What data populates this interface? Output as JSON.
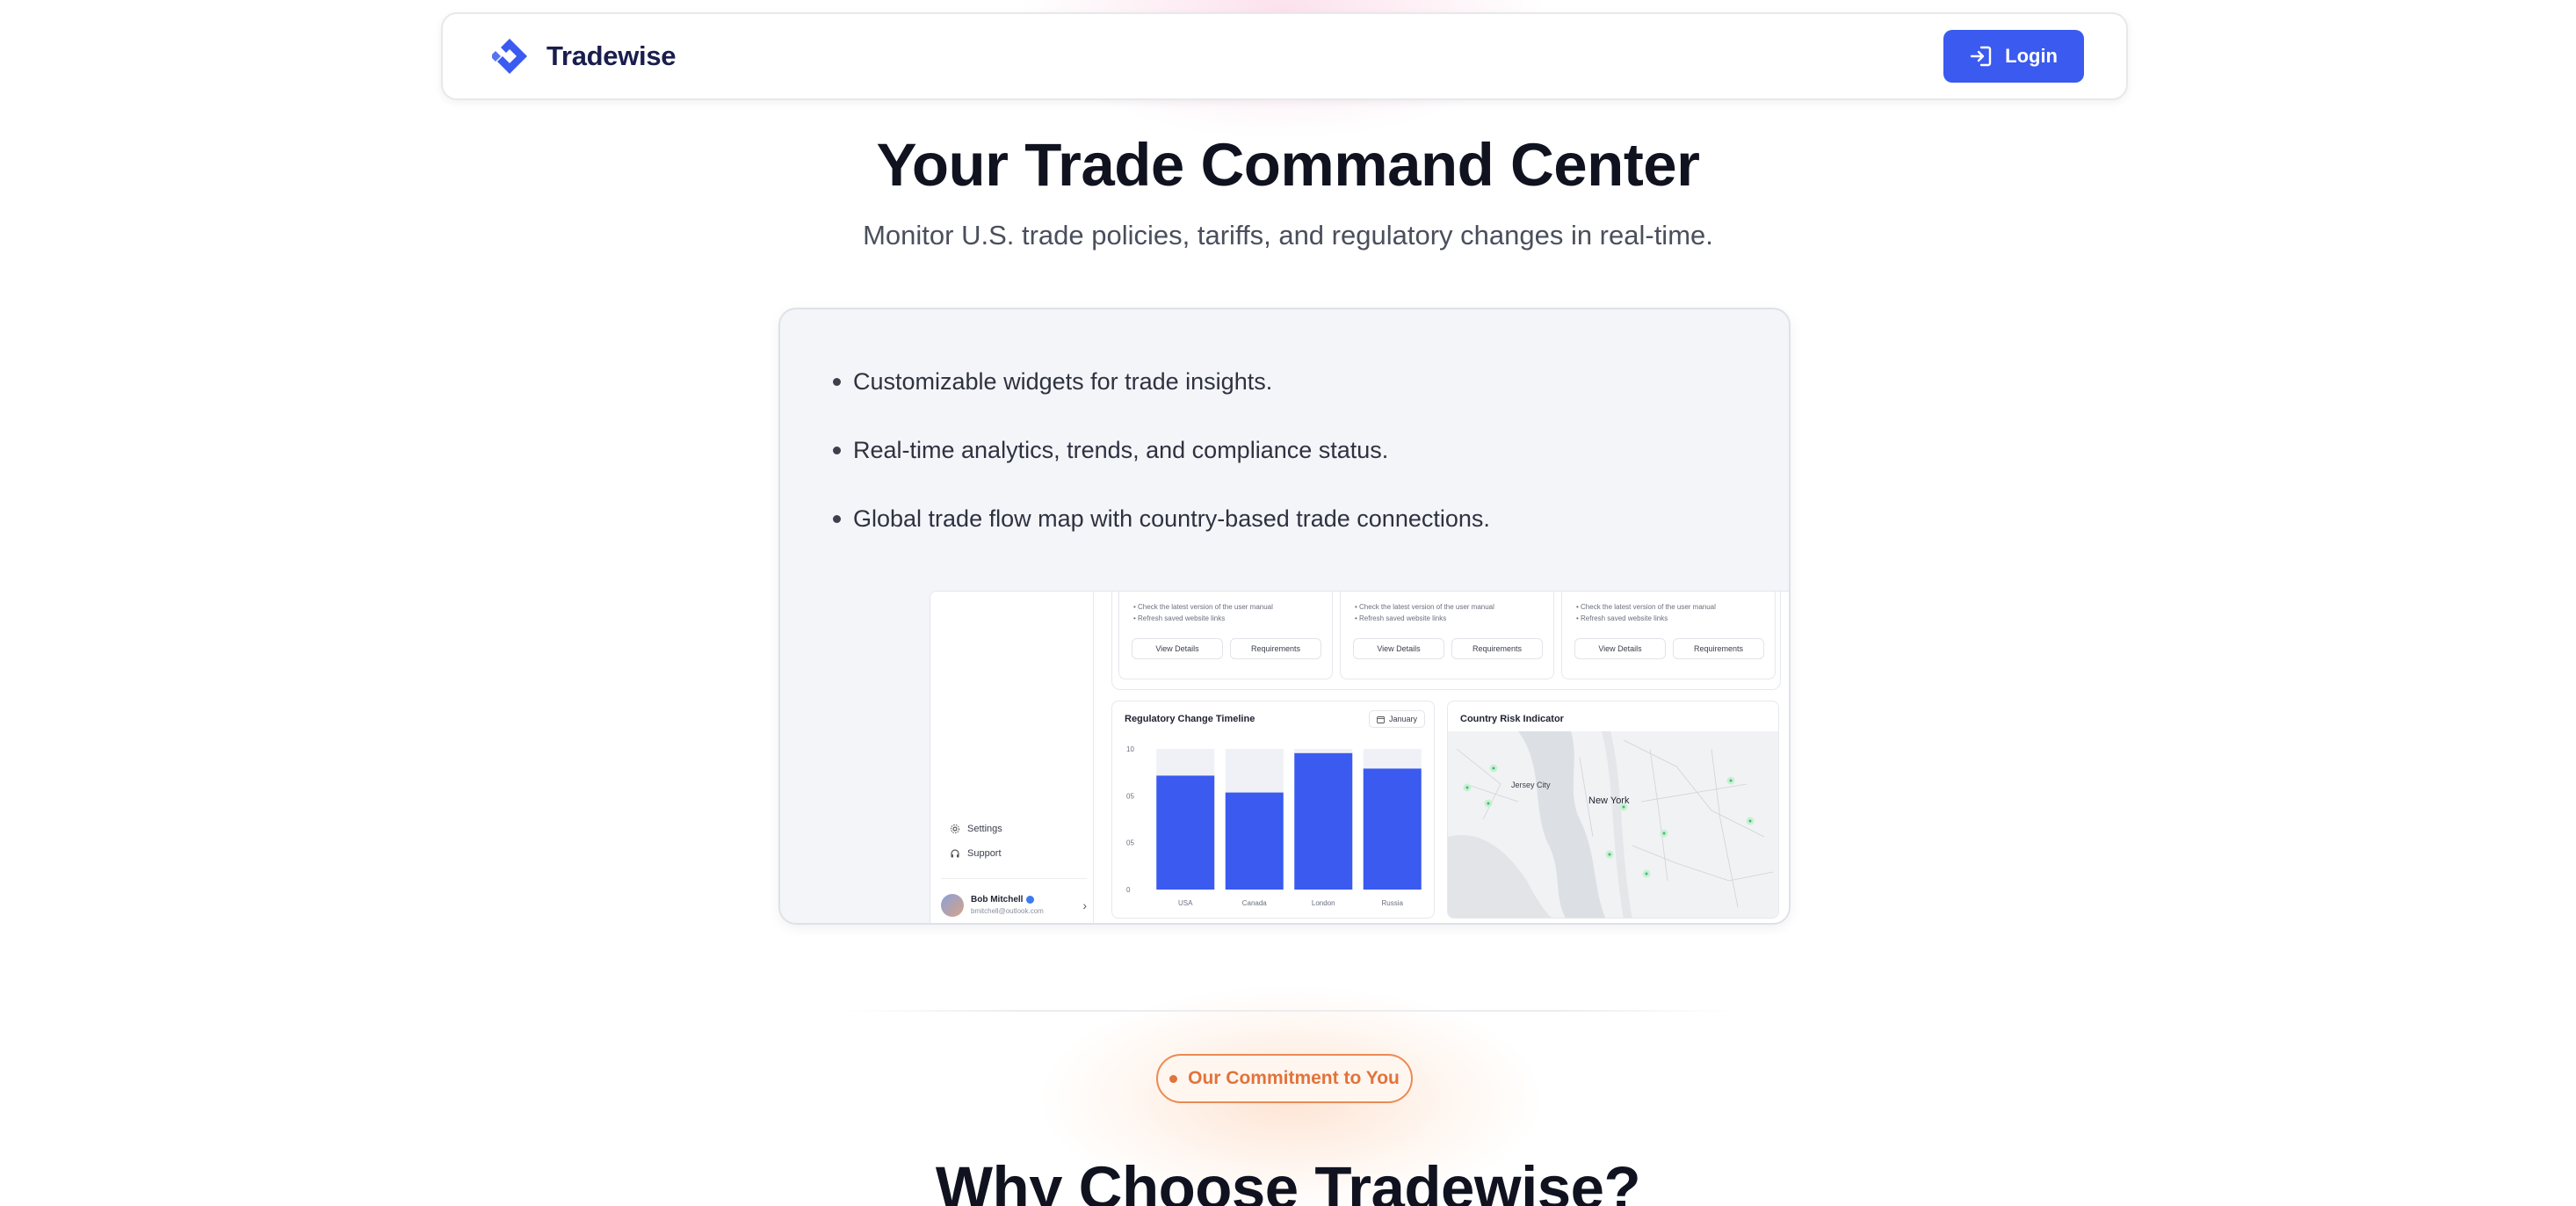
{
  "header": {
    "brand": "Tradewise",
    "login_label": "Login"
  },
  "hero": {
    "title": "Your Trade Command Center",
    "subtitle": "Monitor U.S. trade policies, tariffs, and regulatory changes in real-time."
  },
  "features": [
    "Customizable widgets for trade insights.",
    "Real-time analytics, trends, and compliance status.",
    "Global trade flow map with country-based trade connections."
  ],
  "preview": {
    "sidebar": {
      "items": [
        "Settings",
        "Support"
      ],
      "user_name": "Bob Mitchell",
      "user_email": "bmitchell@outlook.com"
    },
    "mini_cards": [
      {
        "lines": [
          "Check the latest version of the user manual",
          "Refresh saved website links"
        ],
        "details_label": "View Details",
        "requirements_label": "Requirements"
      },
      {
        "lines": [
          "Check the latest version of the user manual",
          "Refresh saved website links"
        ],
        "details_label": "View Details",
        "requirements_label": "Requirements"
      },
      {
        "lines": [
          "Check the latest version of the user manual",
          "Refresh saved website links"
        ],
        "details_label": "View Details",
        "requirements_label": "Requirements"
      }
    ],
    "chart_title": "Regulatory Change Timeline",
    "month_selector": "January",
    "map_title": "Country Risk Indicator",
    "map_labels": [
      "Jersey City",
      "New York"
    ]
  },
  "chart_data": {
    "type": "bar",
    "title": "Regulatory Change Timeline",
    "categories": [
      "USA",
      "Canada",
      "London",
      "Russia"
    ],
    "values": [
      8.1,
      6.9,
      9.7,
      8.6
    ],
    "ylim": [
      0,
      10
    ],
    "yticks": [
      "0",
      "05",
      "05",
      "10"
    ],
    "grid": false,
    "colors": {
      "bar": "#3a5af0",
      "track": "#eff1f6"
    }
  },
  "section": {
    "badge": "Our Commitment to You",
    "title": "Why Choose Tradewise?"
  },
  "colors": {
    "primary": "#3a5af0",
    "brand_text": "#1a1d4e",
    "badge_orange": "#e2733a",
    "map_marker": "#3fbf6a"
  },
  "icons": {
    "brand": "tradewise-logo-icon",
    "login": "login-icon",
    "settings": "gear-icon",
    "support": "headphones-icon",
    "calendar": "calendar-icon"
  }
}
